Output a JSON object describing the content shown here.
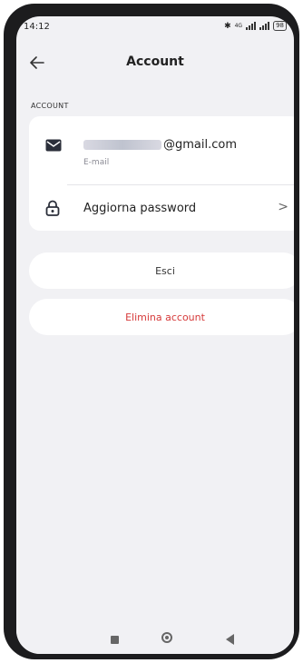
{
  "status_bar": {
    "time": "14:12",
    "bluetooth": "✱",
    "network": "4G",
    "battery": "98"
  },
  "app_bar": {
    "back_icon": "arrow-left-icon",
    "title": "Account"
  },
  "section": {
    "header": "ACCOUNT"
  },
  "account_card": {
    "email": {
      "icon": "mail-icon",
      "value_visible": "@gmail.com",
      "caption": "E-mail"
    },
    "password": {
      "icon": "lock-icon",
      "label": "Aggiorna password",
      "chevron": ">"
    }
  },
  "buttons": {
    "logout": "Esci",
    "delete_account": "Elimina account"
  },
  "colors": {
    "background": "#f1f1f4",
    "card": "#ffffff",
    "danger": "#d63a3a"
  },
  "navigation_bar": {
    "items": [
      "recent-apps-icon",
      "home-icon",
      "back-icon"
    ]
  }
}
